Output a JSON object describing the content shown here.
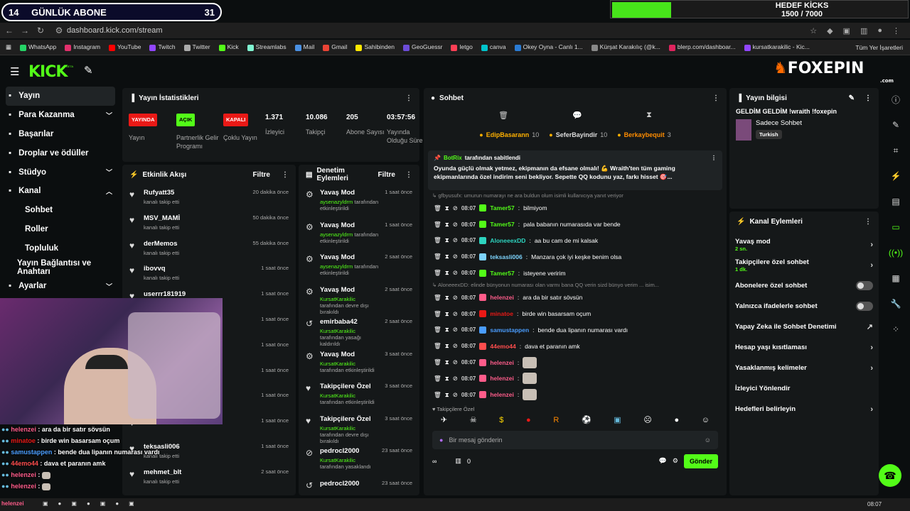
{
  "overlay": {
    "sub_count": "14",
    "sub_label": "GÜNLÜK ABONE",
    "sub_goal": "31",
    "kicks_title": "HEDEF KİCKS",
    "kicks_value": "1500 / 7000",
    "kicks_progress": 0.2
  },
  "browser": {
    "url": "dashboard.kick.com/stream",
    "bookmarks": [
      {
        "label": "WhatsApp",
        "color": "#25d366"
      },
      {
        "label": "Instagram",
        "color": "#e1306c"
      },
      {
        "label": "YouTube",
        "color": "#ff0000"
      },
      {
        "label": "Twitch",
        "color": "#9146ff"
      },
      {
        "label": "Twitter",
        "color": "#aaaaaa"
      },
      {
        "label": "Kick",
        "color": "#53fc18"
      },
      {
        "label": "Streamlabs",
        "color": "#80f5d2"
      },
      {
        "label": "Mail",
        "color": "#4a90e2"
      },
      {
        "label": "Gmail",
        "color": "#ea4335"
      },
      {
        "label": "Sahibinden",
        "color": "#ffe800"
      },
      {
        "label": "GeoGuessr",
        "color": "#6c4cd8"
      },
      {
        "label": "letgo",
        "color": "#ff3f55"
      },
      {
        "label": "canva",
        "color": "#00c4cc"
      },
      {
        "label": "Okey Oyna - Canlı 1...",
        "color": "#2a7bd3"
      },
      {
        "label": "Kürşat Karakılıç (@k...",
        "color": "#888888"
      },
      {
        "label": "blerp.com/dashboar...",
        "color": "#e0245e"
      },
      {
        "label": "kursatkarakilic - Kic...",
        "color": "#9146ff"
      }
    ],
    "all_bookmarks": "Tüm Yer İşaretleri"
  },
  "header": {
    "logo": "KICK",
    "beta": "BETA",
    "brand": "FOXEPIN",
    "brand_sub": ".com"
  },
  "sidebar": {
    "items": [
      {
        "label": "Yayın",
        "icon": "broadcast-icon",
        "active": true
      },
      {
        "label": "Para Kazanma",
        "icon": "money-icon",
        "chev": "v"
      },
      {
        "label": "Başarılar",
        "icon": "trophy-icon"
      },
      {
        "label": "Droplar ve ödüller",
        "icon": "gift-icon"
      },
      {
        "label": "Stüdyo",
        "icon": "studio-icon",
        "chev": "v"
      },
      {
        "label": "Kanal",
        "icon": "channel-icon",
        "chev": "^"
      },
      {
        "label": "Sohbet",
        "sub": true
      },
      {
        "label": "Roller",
        "sub": true
      },
      {
        "label": "Topluluk",
        "sub": true
      },
      {
        "label": "Yayın Bağlantısı ve Anahtarı",
        "sub": true
      },
      {
        "label": "Ayarlar",
        "icon": "settings-icon",
        "chev": "v"
      }
    ]
  },
  "stats": {
    "title": "Yayın İstatistikleri",
    "items": [
      {
        "tag": "YAYINDA",
        "tag_color": "#e91916",
        "label": "Yayın"
      },
      {
        "tag": "AÇIK",
        "tag_color": "#53fc18",
        "label": "Partnerlik Gelir Programı"
      },
      {
        "tag": "KAPALI",
        "tag_color": "#e91916",
        "label": "Çoklu Yayın"
      },
      {
        "value": "1.371",
        "label": "İzleyici"
      },
      {
        "value": "10.086",
        "label": "Takipçi"
      },
      {
        "value": "205",
        "label": "Abone Sayısı"
      },
      {
        "value": "03:57:56",
        "label": "Yayında Olduğu Süre"
      }
    ]
  },
  "events": {
    "title": "Etkinlik Akışı",
    "filter": "Filtre",
    "items": [
      {
        "name": "Rufyatt35",
        "sub": "kanalı takip etti",
        "time": "20 dakika önce"
      },
      {
        "name": "MSV_MAMİ",
        "sub": "kanalı takip etti",
        "time": "50 dakika önce"
      },
      {
        "name": "derMemos",
        "sub": "kanalı takip etti",
        "time": "55 dakika önce"
      },
      {
        "name": "ibovvq",
        "sub": "kanalı takip etti",
        "time": "1 saat önce"
      },
      {
        "name": "userrr181919",
        "sub": "",
        "time": "1 saat önce"
      },
      {
        "name": "",
        "sub": "",
        "time": "1 saat önce"
      },
      {
        "name": "",
        "sub": "",
        "time": "1 saat önce"
      },
      {
        "name": "",
        "sub": "",
        "time": "1 saat önce"
      },
      {
        "name": "",
        "sub": "",
        "time": "1 saat önce"
      },
      {
        "name": "",
        "sub": "",
        "time": "1 saat önce"
      },
      {
        "name": "teksasli006",
        "sub": "kanalı takip etti",
        "time": "1 saat önce"
      },
      {
        "name": "mehmet_blt",
        "sub": "kanalı takip etti",
        "time": "2 saat önce"
      }
    ]
  },
  "mod": {
    "title": "Denetim Eylemleri",
    "filter": "Filtre",
    "items": [
      {
        "t": "Yavaş Mod",
        "u": "aysenazyldrm",
        "s": "tarafından etkinleştirildi",
        "time": "1 saat önce"
      },
      {
        "t": "Yavaş Mod",
        "u": "aysenazyldrm",
        "s": "tarafından etkinleştirildi",
        "time": "1 saat önce"
      },
      {
        "t": "Yavaş Mod",
        "u": "aysenazyldrm",
        "s": "tarafından etkinleştirildi",
        "time": "2 saat önce"
      },
      {
        "t": "Yavaş Mod",
        "u": "KursatKarakilic",
        "s": "tarafından devre dışı bırakıldı",
        "time": "2 saat önce"
      },
      {
        "t": "emirbaba42",
        "u": "KursatKarakilic",
        "s": "tarafından yasağı kaldırıldı",
        "time": "2 saat önce"
      },
      {
        "t": "Yavaş Mod",
        "u": "KursatKarakilic",
        "s": "tarafından etkinleştirildi",
        "time": "3 saat önce"
      },
      {
        "t": "Takipçilere Özel",
        "u": "KursatKarakilic",
        "s": "tarafından etkinleştirildi",
        "time": "3 saat önce"
      },
      {
        "t": "Takipçilere Özel",
        "u": "KursatKarakilic",
        "s": "tarafından devre dışı bırakıldı",
        "time": "3 saat önce"
      },
      {
        "t": "pedrocl2000",
        "u": "KursatKarakilic",
        "s": "tarafından yasaklandı",
        "time": "23 saat önce"
      },
      {
        "t": "pedrocl2000",
        "u": "",
        "s": "",
        "time": "23 saat önce"
      }
    ]
  },
  "chat": {
    "title": "Sohbet",
    "top": [
      {
        "name": "EdipBasarann",
        "n": "10"
      },
      {
        "name": "SeferBayindir",
        "n": "10"
      },
      {
        "name": "Berkaybequit",
        "n": "3"
      }
    ],
    "pinned_by": "BotRix",
    "pinned_suffix": "tarafından sabitlendi",
    "pinned_text": "Oyunda güçlü olmak yetmez, ekipmanın da efsane olmalı! 💪 Wraith'ten tüm gaming ekipmanlarında özel indirim seni bekliyor. Sepette QQ kodunu yaz, farkı hisset 🎯...",
    "reply1": "↳ gfbyusufx: umurun numarayı ne ara buldun olum isimli kullanıcıya yanıt veriyor",
    "reply2": "↳ AloneeexDD: elinde bünyonun numarası olan varmı bana QQ verin sizd bünyo verim ... isim...",
    "messages": [
      {
        "time": "08:07",
        "user": "Tamer57",
        "color": "#53fc18",
        "text": "bilmiyom"
      },
      {
        "time": "08:07",
        "user": "Tamer57",
        "color": "#53fc18",
        "text": "pala babanın numarasıda var bende"
      },
      {
        "time": "08:07",
        "user": "AloneeexDD",
        "color": "#2dd4bf",
        "text": "aa bu cam de mi kalsak"
      },
      {
        "time": "08:07",
        "user": "teksasli006",
        "color": "#7dd3fc",
        "text": "Manzara çok iyi keşke benim olsa"
      },
      {
        "time": "08:07",
        "user": "Tamer57",
        "color": "#53fc18",
        "text": "isteyene veririm"
      },
      {
        "time": "08:07",
        "user": "helenzei",
        "color": "#ff5c8a",
        "text": "ara da bir satır sövsün"
      },
      {
        "time": "08:07",
        "user": "minatoe",
        "color": "#e91916",
        "text": "birde win basarsam oçum"
      },
      {
        "time": "08:07",
        "user": "samustappen",
        "color": "#4a9dff",
        "text": "bende dua lipanın numarası vardı"
      },
      {
        "time": "08:07",
        "user": "44emo44",
        "color": "#ff4d4d",
        "text": "dava et paranın amk"
      },
      {
        "time": "08:07",
        "user": "helenzei",
        "color": "#ff5c8a",
        "text": ""
      },
      {
        "time": "08:07",
        "user": "helenzei",
        "color": "#ff5c8a",
        "text": ""
      },
      {
        "time": "08:07",
        "user": "helenzei",
        "color": "#ff5c8a",
        "text": ""
      }
    ],
    "followers_only": "Takipçilere Özel",
    "placeholder": "Bir mesaj gönderin",
    "send": "Gönder",
    "count": "0"
  },
  "info": {
    "title": "Yayın bilgisi",
    "stream_title": "GELDİM GELDİM !wraith !foxepin",
    "category": "Sadece Sohbet",
    "lang": "Turkish"
  },
  "actions": {
    "title": "Kanal Eylemleri",
    "items": [
      {
        "label": "Yavaş mod",
        "sub": "2 sn.",
        "kind": "chev"
      },
      {
        "label": "Takipçilere özel sohbet",
        "sub": "1 dk.",
        "kind": "chev"
      },
      {
        "label": "Abonelere özel sohbet",
        "sub": "",
        "kind": "toggle"
      },
      {
        "label": "Yalnızca ifadelerle sohbet",
        "sub": "",
        "kind": "toggle"
      },
      {
        "label": "Yapay Zeka ile Sohbet Denetimi",
        "sub": "",
        "kind": "ext"
      },
      {
        "label": "Hesap yaşı kısıtlaması",
        "sub": "",
        "kind": "chev"
      },
      {
        "label": "Yasaklanmış kelimeler",
        "sub": "",
        "kind": "chev"
      },
      {
        "label": "İzleyici Yönlendir",
        "sub": "",
        "kind": ""
      },
      {
        "label": "Hedefleri belirleyin",
        "sub": "",
        "kind": "chev"
      }
    ]
  },
  "overlay_chat": [
    {
      "user": "helenzei",
      "color": "#ff5c8a",
      "text": "ara da bir satır sövsün"
    },
    {
      "user": "minatoe",
      "color": "#e91916",
      "text": "birde win basarsam oçum"
    },
    {
      "user": "samustappen",
      "color": "#4a9dff",
      "text": "bende dua lipanın numarası vardı"
    },
    {
      "user": "44emo44",
      "color": "#ff4d4d",
      "text": "dava et paranın amk"
    },
    {
      "user": "helenzei",
      "color": "#ff5c8a",
      "text": ""
    },
    {
      "user": "helenzei",
      "color": "#ff5c8a",
      "text": ""
    }
  ],
  "taskbar": {
    "time": "08:07",
    "overlay_name": "helenzei"
  }
}
